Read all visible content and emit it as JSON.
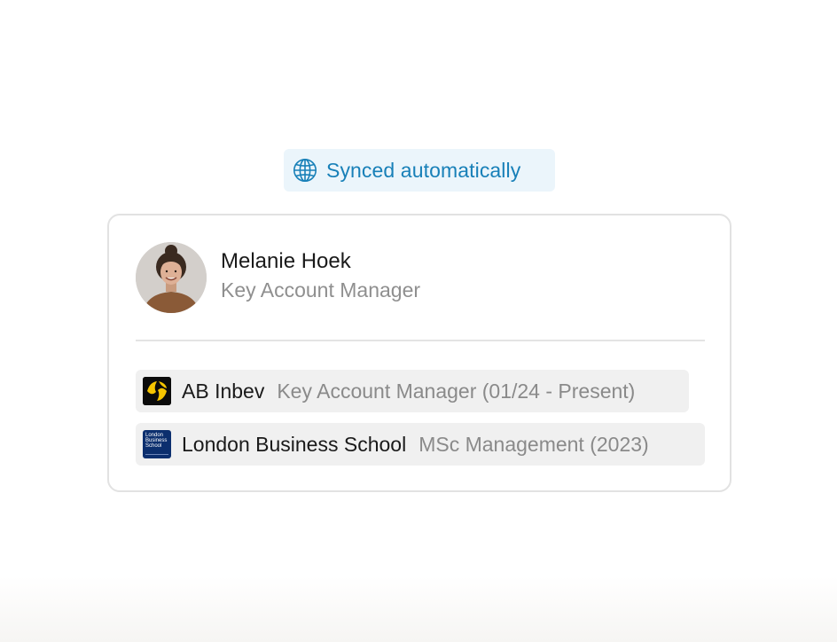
{
  "sync": {
    "icon": "globe-icon",
    "label": "Synced automatically",
    "color": "#1880b8",
    "background": "#ebf5fb"
  },
  "profile": {
    "name": "Melanie Hoek",
    "title": "Key Account Manager"
  },
  "experience": [
    {
      "logo": "ab-inbev-logo",
      "organization": "AB Inbev",
      "detail": "Key Account Manager (01/24 - Present)"
    },
    {
      "logo": "london-business-school-logo",
      "logo_text": [
        "London",
        "Business",
        "School"
      ],
      "organization": "London Business School",
      "detail": "MSc Management (2023)"
    }
  ]
}
